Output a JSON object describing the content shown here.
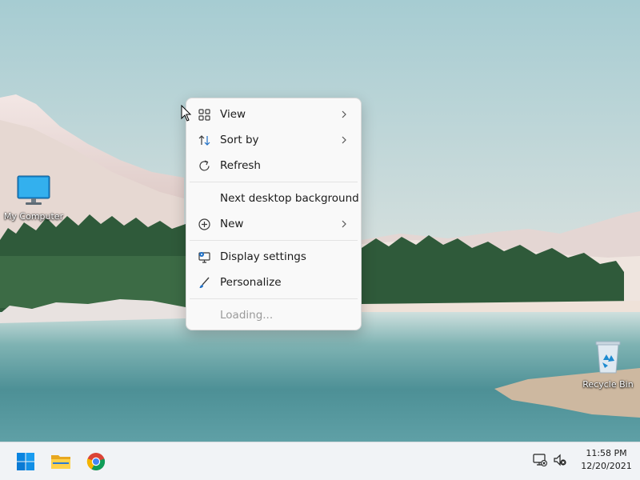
{
  "desktop": {
    "icons": [
      {
        "label": "My Computer",
        "icon": "monitor-icon"
      },
      {
        "label": "Recycle Bin",
        "icon": "recycle-bin-icon"
      }
    ]
  },
  "context_menu": {
    "items": [
      {
        "label": "View",
        "icon": "grid-icon",
        "submenu": true
      },
      {
        "label": "Sort by",
        "icon": "sort-arrows-icon",
        "submenu": true
      },
      {
        "label": "Refresh",
        "icon": "refresh-icon",
        "submenu": false
      },
      {
        "label": "Next desktop background",
        "icon": "",
        "submenu": false
      },
      {
        "label": "New",
        "icon": "plus-circle-icon",
        "submenu": true
      },
      {
        "label": "Display settings",
        "icon": "display-settings-icon",
        "submenu": false
      },
      {
        "label": "Personalize",
        "icon": "brush-icon",
        "submenu": false
      },
      {
        "label": "Loading...",
        "icon": "",
        "submenu": false,
        "disabled": true
      }
    ]
  },
  "taskbar": {
    "pinned": [
      "windows-start-icon",
      "file-explorer-icon",
      "chrome-icon"
    ],
    "tray": [
      "network-icon",
      "volume-muted-icon"
    ],
    "clock": {
      "time": "11:58 PM",
      "date": "12/20/2021"
    }
  },
  "colors": {
    "accent": "#0078d4",
    "taskbar_bg": "#f1f3f6",
    "menu_bg": "#f9f9f9"
  }
}
